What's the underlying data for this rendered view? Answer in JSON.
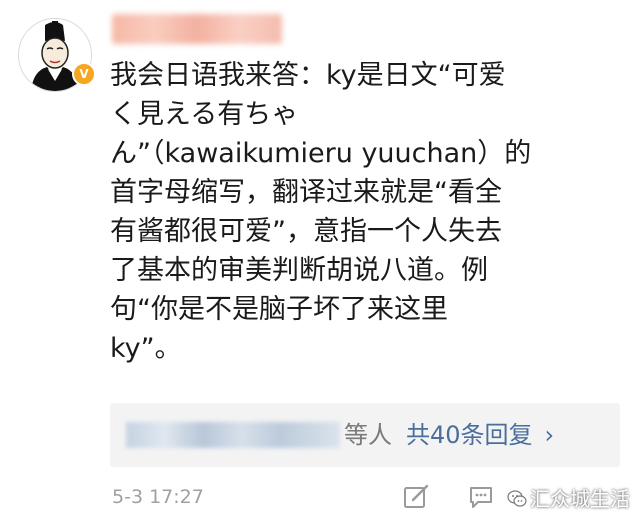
{
  "comment": {
    "lines": [
      "我会日语我来答：ky是日文“可爱",
      "く見える有ちゃ",
      "ん”（kawaikumieru yuuchan）的",
      "首字母缩写，翻译过来就是“看全",
      "有酱都很可爱”，意指一个人失去",
      "了基本的审美判断胡说八道。例",
      "句“你是不是脑子坏了来这里",
      "ky”。"
    ]
  },
  "avatar": {
    "badge": "V",
    "badge_color": "#f5a623"
  },
  "replies": {
    "who": "等人",
    "count_label": "共40条回复",
    "chevron": "›",
    "link_color": "#4a6e9c"
  },
  "footer": {
    "timestamp": "5-3 17:27",
    "icons": [
      "edit-icon",
      "comment-icon",
      "like-icon"
    ]
  },
  "watermark": {
    "text": "汇众城生活",
    "icon": "wechat-icon"
  }
}
